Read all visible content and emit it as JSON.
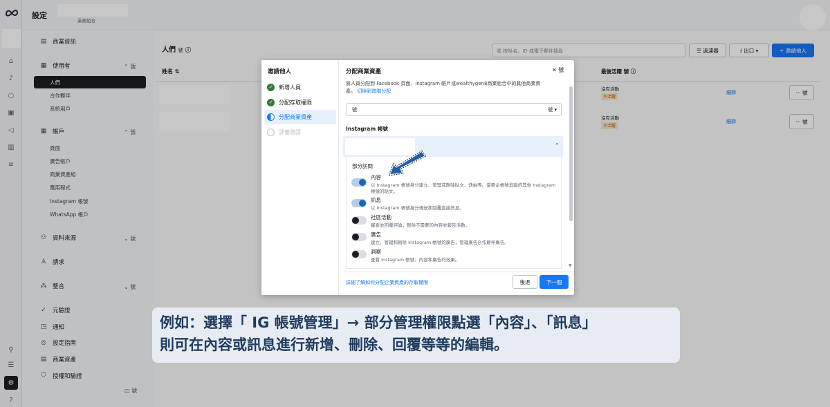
{
  "topbar": {
    "title": "設定",
    "subtitle": "業務組合"
  },
  "sidebar": {
    "business_info": "商業資訊",
    "users": {
      "label": "使用者",
      "items": [
        "人們",
        "合作夥伴",
        "系統用戶"
      ]
    },
    "accounts": {
      "label": "帳戶",
      "items": [
        "頁面",
        "廣告帳戶",
        "商業資產組",
        "應用程式",
        "Instagram 帳號",
        "WhatsApp 帳戶"
      ]
    },
    "data_sources": "資料來源",
    "requests": "請求",
    "integrations": "整合",
    "bottom": [
      "元驗證",
      "通知",
      "設定指南",
      "商業資產",
      "授權和驗證"
    ],
    "collapse_glyph": "號"
  },
  "people": {
    "title": "人們",
    "count": "號",
    "search_placeholder": "號  按姓名、ID 或電子郵件搜尋",
    "filter_label": "過濾器",
    "export_label": "出口",
    "invite_label": "邀請他人",
    "col_name": "姓名",
    "col_last_active": "最後活躍",
    "col_suffix": "號",
    "rows": [
      {
        "status": "沒有活動",
        "badge": "不活躍",
        "link": "細節",
        "more": "··· 號"
      },
      {
        "status": "沒有活動",
        "badge": "不活躍",
        "link": "細節",
        "more": "··· 號"
      }
    ]
  },
  "modal": {
    "steps": [
      "邀請他人",
      "新增人員",
      "分配存取權限",
      "分配商業資產",
      "評審邀請"
    ],
    "title": "分配商業資產",
    "close": "號",
    "desc_line1": "將人員分配到 Facebook 頁面、Instagram 帳戶或wealthygen8商業組合中的其他商業資",
    "desc_line2_a": "產。",
    "desc_line2_link": "切換到進階分配",
    "select_value": "號",
    "select_suffix": "號",
    "section_label": "Instagram 帳號",
    "partial_access": "部分訪問",
    "permissions": [
      {
        "title": "內容",
        "desc1": "以 Instagram 帳號身分建立、管理或刪除貼文、快拍等。還要企帳號追蹤的其他 Instagram",
        "desc2": "帳號的貼文。",
        "on": true
      },
      {
        "title": "訊息",
        "desc1": "以 Instagram 帳號身分傳送和回覆直接訊息。",
        "desc2": "",
        "on": true
      },
      {
        "title": "社區活動",
        "desc1": "審查並回覆評論，刪除不需要的內容並報告活動。",
        "desc2": "",
        "on": false
      },
      {
        "title": "廣告",
        "desc1": "建立、管理和刪除 Instagram 帳號的廣告，管理廣告合作夥伴廣告。",
        "desc2": "",
        "on": false
      },
      {
        "title": "洞察",
        "desc1": "查看 Instagram 帳號、內容和廣告的效果。",
        "desc2": "",
        "on": false
      }
    ],
    "learn_more": "詳細了解如何分配企業資產的存取權限",
    "back": "後退",
    "next": "下一個"
  },
  "caption": {
    "line1": "例如：選擇「 IG 帳號管理」→ 部分管理權限點選「內容」、「訊息」",
    "line2": "則可在內容或訊息進行新增、刪除、回覆等等的編輯。"
  },
  "colors": {
    "accent": "#1877f2",
    "arrow": "#1f5fa8",
    "caption_text": "#1f3b5e",
    "caption_bg": "#e7ecf4"
  }
}
